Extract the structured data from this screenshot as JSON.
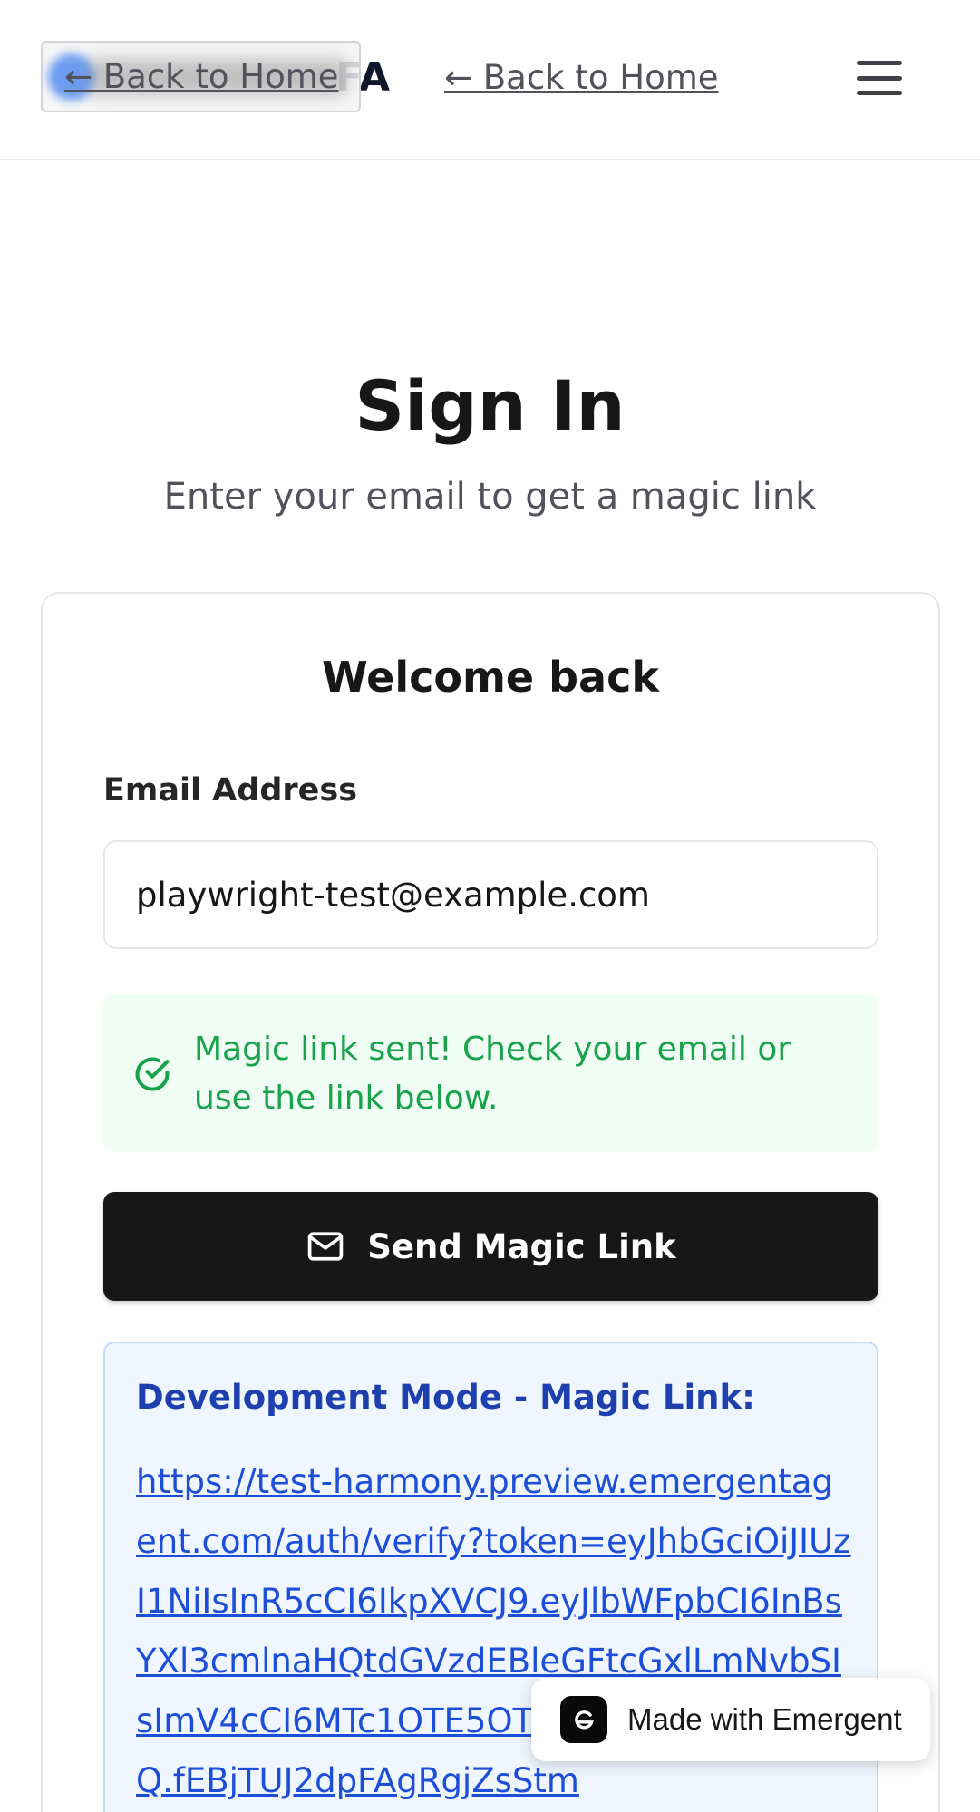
{
  "header": {
    "brand_fragment": "FA",
    "overlay_back_label": "← Back to Home",
    "back_label": "← Back to Home",
    "menu_icon": "hamburger-icon"
  },
  "page": {
    "title": "Sign In",
    "subtitle": "Enter your email to get a magic link"
  },
  "card": {
    "title": "Welcome back",
    "email_label": "Email Address",
    "email_value": "playwright-test@example.com",
    "success_message": "Magic link sent! Check your email or use the link below.",
    "success_icon": "check-circle-icon",
    "send_button_label": "Send Magic Link",
    "send_button_icon": "mail-icon",
    "dev_title": "Development Mode - Magic Link:",
    "dev_link": "https://test-harmony.preview.emergentagent.com/auth/verify?token=eyJhbGciOiJIUzI1NiIsInR5cCI6IkpXVCJ9.eyJlbWFpbCI6InBsYXl3cmlnaHQtdGVzdEBleGFtcGxlLmNvbSIsImV4cCI6MTc1OTE5OTYhZ2IjX2xpbmsifQ.fEBjTUJ2dpFAgRgjZsStm"
  },
  "badge": {
    "label": "Made with Emergent",
    "icon": "emergent-logo-icon"
  },
  "colors": {
    "primary_button": "#171717",
    "success_text": "#16a34a",
    "success_bg": "#f0fdf4",
    "dev_bg": "#eff6ff",
    "dev_link": "#1d4ed8"
  }
}
